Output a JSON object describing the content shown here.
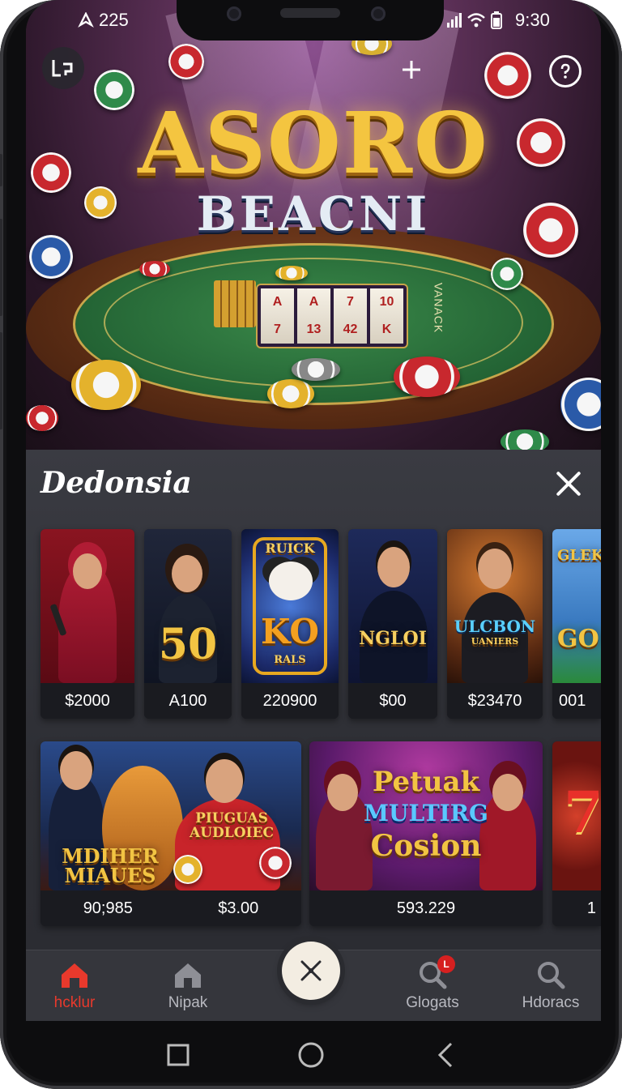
{
  "status_bar": {
    "left_text": "225",
    "time": "9:30"
  },
  "hero": {
    "title_line1": "ASORO",
    "title_line2": "BEACNI",
    "reels": [
      [
        "A",
        "7"
      ],
      [
        "A",
        "13"
      ],
      [
        "7",
        "42"
      ],
      [
        "10",
        "K"
      ]
    ],
    "felt_text": "VANACK"
  },
  "panel": {
    "title": "Dedonsia",
    "row1": [
      {
        "price": "$2000"
      },
      {
        "price": "A100",
        "art_text": "50"
      },
      {
        "price": "220900",
        "art_text": "KO",
        "art_top": "RUICK",
        "art_sub": "RALS"
      },
      {
        "price": "$00",
        "art_text": "NGLOI"
      },
      {
        "price": "$23470",
        "art_text": "ULCBON",
        "art_sub": "UANIERS"
      },
      {
        "price": "001",
        "art_text": "GO",
        "art_top": "GLEK"
      }
    ],
    "row2": [
      {
        "price_left": "90;985",
        "price_right": "$3.00",
        "art_text": "MDIHER MIAUES",
        "art_tshirt": "PIUGUAS AUDLOIEC"
      },
      {
        "price": "593.229",
        "art_line1": "Petuak",
        "art_line2": "MULTIRG",
        "art_line3": "Cosion"
      },
      {
        "price": "1",
        "art_text": "7"
      }
    ]
  },
  "bottom_nav": {
    "items": [
      {
        "label": "hcklur",
        "icon": "home-icon",
        "active": true
      },
      {
        "label": "Nipak",
        "icon": "house-icon",
        "active": false
      },
      {
        "label": "Glogats",
        "icon": "search-icon",
        "active": false,
        "badge": "L"
      },
      {
        "label": "Hdoracs",
        "icon": "search-icon",
        "active": false
      }
    ]
  },
  "colors": {
    "accent": "#e8392c",
    "gold": "#f4c540",
    "felt": "#236334",
    "panel": "#2e2f35"
  }
}
